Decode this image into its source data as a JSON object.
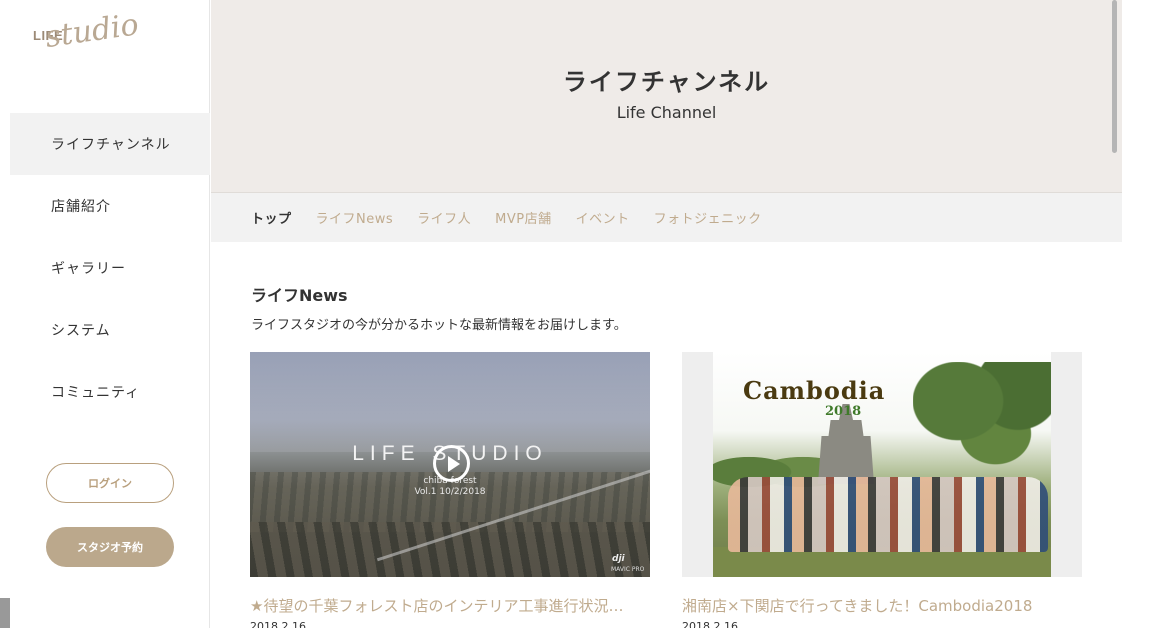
{
  "logo": {
    "life": "LIFE",
    "studio": "studio"
  },
  "sidebar": {
    "items": [
      {
        "label": "ライフチャンネル",
        "active": true
      },
      {
        "label": "店舗紹介"
      },
      {
        "label": "ギャラリー"
      },
      {
        "label": "システム"
      },
      {
        "label": "コミュニティ"
      }
    ],
    "login_label": "ログイン",
    "reserve_label": "スタジオ予約"
  },
  "hero": {
    "title": "ライフチャンネル",
    "subtitle": "Life Channel"
  },
  "tabs": [
    {
      "label": "トップ",
      "active": true
    },
    {
      "label": "ライフNews"
    },
    {
      "label": "ライフ人"
    },
    {
      "label": "MVP店舗"
    },
    {
      "label": "イベント"
    },
    {
      "label": "フォトジェニック"
    }
  ],
  "section": {
    "title": "ライフNews",
    "description": "ライフスタジオの今が分かるホットな最新情報をお届けします。"
  },
  "cards": [
    {
      "video_title": "LIFE STUDIO",
      "video_caption_1": "chiba forest",
      "video_caption_2": "Vol.1 10/2/2018",
      "watermark_brand": "dji",
      "watermark_model": "MAVIC PRO",
      "title": "★待望の千葉フォレスト店のインテリア工事進行状況…",
      "date": "2018.2.16"
    },
    {
      "photo_text": "Cambodia",
      "photo_year": "2018",
      "title": "湘南店×下関店で行ってきました！Cambodia2018",
      "date": "2018.2.16"
    }
  ],
  "colors": {
    "accent": "#c0ab8e",
    "hero_bg": "#efebe8",
    "tab_bg": "#f2f2f2",
    "reserve_btn": "#bba88c"
  }
}
